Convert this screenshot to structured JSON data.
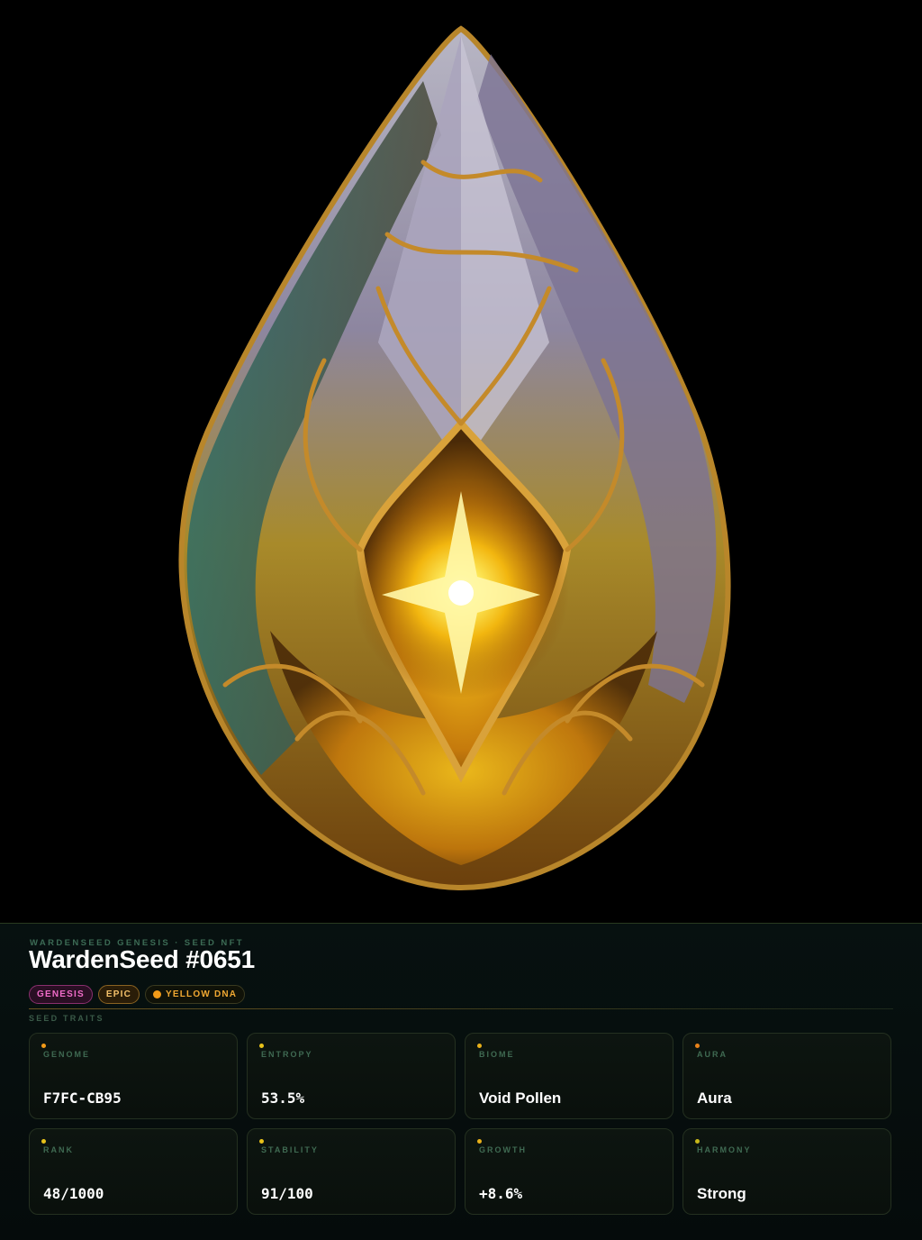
{
  "header": {
    "eyebrow": "WARDENSEED GENESIS · SEED NFT",
    "title": "WardenSeed #0651"
  },
  "badges": [
    {
      "label": "GENESIS"
    },
    {
      "label": "EPIC"
    },
    {
      "label": "YELLOW DNA",
      "dot_color": "#f29a18"
    }
  ],
  "traits_label": "SEED TRAITS",
  "traits": [
    {
      "label": "GENOME",
      "value": "F7FC-CB95",
      "dot_color": "#f29a18",
      "mono": true
    },
    {
      "label": "ENTROPY",
      "value": "53.5%",
      "dot_color": "#e8c21a",
      "mono": true
    },
    {
      "label": "BIOME",
      "value": "Void Pollen",
      "dot_color": "#e8b01a",
      "mono": false
    },
    {
      "label": "AURA",
      "value": "Aura",
      "dot_color": "#e8821a",
      "mono": false
    },
    {
      "label": "RANK",
      "value": "48/1000",
      "dot_color": "#e8c21a",
      "mono": true
    },
    {
      "label": "STABILITY",
      "value": "91/100",
      "dot_color": "#e8c21a",
      "mono": true
    },
    {
      "label": "GROWTH",
      "value": "+8.6%",
      "dot_color": "#e8b01a",
      "mono": true
    },
    {
      "label": "HARMONY",
      "value": "Strong",
      "dot_color": "#c8b81a",
      "mono": false
    }
  ],
  "colors": {
    "background": "#000000",
    "panel": "#071110",
    "accent_gold": "#f29a18",
    "badge_genesis": "#f06cc9",
    "badge_epic": "#f4c16a"
  },
  "artwork": {
    "icon": "crystal-seed-artwork"
  }
}
